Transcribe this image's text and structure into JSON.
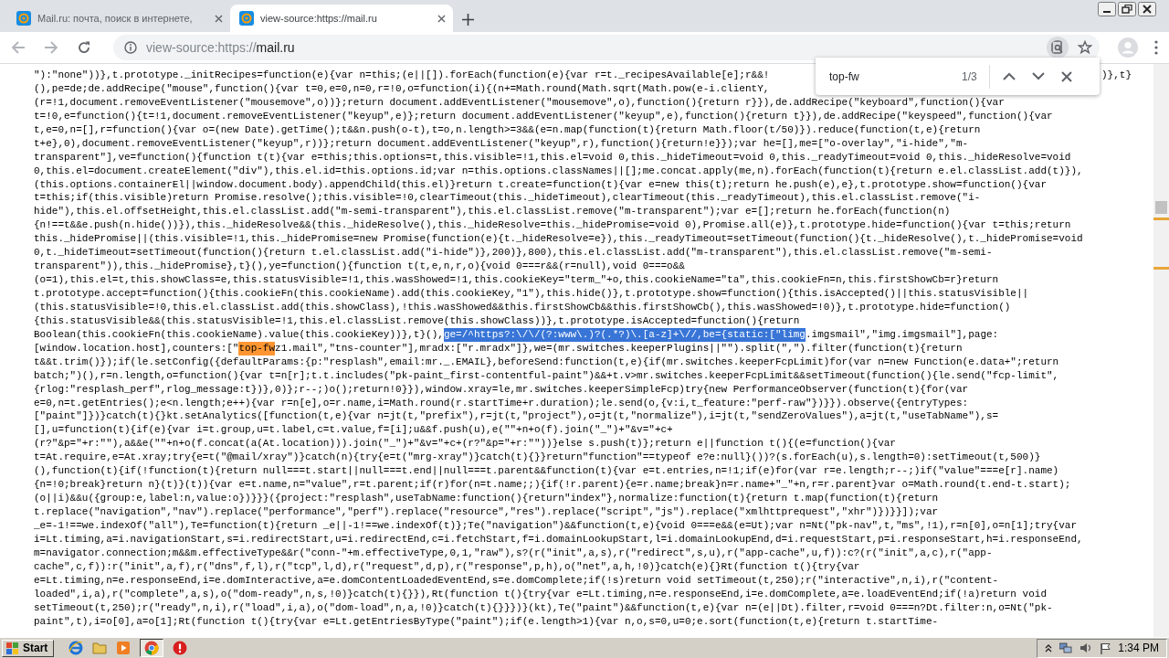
{
  "tabs": [
    {
      "title": "Mail.ru: почта, поиск в интернете,",
      "selected": false
    },
    {
      "title": "view-source:https://mail.ru",
      "selected": true
    }
  ],
  "address": {
    "prefix": "view-source:https://",
    "host": "mail.ru"
  },
  "find": {
    "query": "top-fw",
    "count": "1/3"
  },
  "source_lines": [
    {
      "text": "\"):\"none\"))},t.prototype._initRecipes=function(e){var n=this;(e||[]).forEach(function(e){var r=t._recipesAvailable[e];r&&!",
      "tail": ")},t}"
    },
    {
      "text": "(),pe=de;de.addRecipe(\"mouse\",function(){var t=0,e=0,n=0,r=!0,o=function(i){(n+=Math.round(Math.sqrt(Math.pow(e-i.clientY,"
    },
    {
      "text": "(r=!1,document.removeEventListener(\"mousemove\",o))};return document.addEventListener(\"mousemove\",o),function(){return r}}),de.addRecipe(\"keyboard\",function(){var"
    },
    {
      "text": "t=!0,e=function(){t=!1,document.removeEventListener(\"keyup\",e)};return document.addEventListener(\"keyup\",e),function(){return t}}),de.addRecipe(\"keyspeed\",function(){var"
    },
    {
      "text": "t,e=0,n=[],r=function(){var o=(new Date).getTime();t&&n.push(o-t),t=o,n.length>=3&&(e=n.map(function(t){return Math.floor(t/50)}).reduce(function(t,e){return"
    },
    {
      "text": "t+e},0),document.removeEventListener(\"keyup\",r))};return document.addEventListener(\"keyup\",r),function(){return!e}});var he=[],me=[\"o-overlay\",\"i-hide\",\"m-"
    },
    {
      "text": "transparent\"],ve=function(){function t(t){var e=this;this.options=t,this.visible=!1,this.el=void 0,this._hideTimeout=void 0,this._readyTimeout=void 0,this._hideResolve=void"
    },
    {
      "text": "0,this.el=document.createElement(\"div\"),this.el.id=this.options.id;var n=this.options.classNames||[];me.concat.apply(me,n).forEach(function(t){return e.el.classList.add(t)}),"
    },
    {
      "text": "(this.options.containerEl||window.document.body).appendChild(this.el)}return t.create=function(t){var e=new this(t);return he.push(e),e},t.prototype.show=function(){var"
    },
    {
      "text": "t=this;if(this.visible)return Promise.resolve();this.visible=!0,clearTimeout(this._hideTimeout),clearTimeout(this._readyTimeout),this.el.classList.remove(\"i-"
    },
    {
      "text": "hide\"),this.el.offsetHeight,this.el.classList.add(\"m-semi-transparent\"),this.el.classList.remove(\"m-transparent\");var e=[];return he.forEach(function(n)"
    },
    {
      "text": "{n!==t&&e.push(n.hide())}),this._hideResolve&&(this._hideResolve(),this._hideResolve=this._hidePromise=void 0),Promise.all(e)},t.prototype.hide=function(){var t=this;return"
    },
    {
      "text": "this._hidePromise||(this.visible=!1,this._hidePromise=new Promise(function(e){t._hideResolve=e}),this._readyTimeout=setTimeout(function(){t._hideResolve(),t._hidePromise=void"
    },
    {
      "text": "0,t._hideTimeout=setTimeout(function(){return t.el.classList.add(\"i-hide\")},200)},800),this.el.classList.add(\"m-transparent\"),this.el.classList.remove(\"m-semi-"
    },
    {
      "text": "transparent\")),this._hidePromise},t}(),ye=function(){function t(t,e,n,r,o){void 0===r&&(r=null),void 0===o&&"
    },
    {
      "text": "(o=1),this.el=t,this.showClass=e,this.statusVisible=!1,this.wasShowed=!1,this.cookieKey=\"term_\"+o,this.cookieName=\"ta\",this.cookieFn=n,this.firstShowCb=r}return"
    },
    {
      "text": "t.prototype.accept=function(){this.cookieFn(this.cookieName).add(this.cookieKey,\"1\"),this.hide()},t.prototype.show=function(){this.isAccepted()||this.statusVisible||"
    },
    {
      "text": "(this.statusVisible=!0,this.el.classList.add(this.showClass),!this.wasShowed&&this.firstShowCb&&this.firstShowCb(),this.wasShowed=!0)},t.prototype.hide=function()"
    },
    {
      "text": "{this.statusVisible&&(this.statusVisible=!1,this.el.classList.remove(this.showClass))},t.prototype.isAccepted=function(){return"
    },
    {
      "segments": [
        {
          "text": "Boolean(this.cookieFn(this.cookieName).value(this.cookieKey))},t}(),",
          "kind": "plain"
        },
        {
          "text": "ge=/^https?:\\/\\/(?:www\\.)?(.*?)\\.[a-z]+\\//,be={static:[\"limg",
          "kind": "selection"
        },
        {
          "text": ".imgsmail\",\"img.imgsmail\"],page:",
          "kind": "plain"
        }
      ]
    },
    {
      "segments": [
        {
          "text": "[window.location.host],counters:[\"",
          "kind": "plain"
        },
        {
          "text": "top-fw",
          "kind": "match"
        },
        {
          "text": "z1.mail\",\"tns-counter\"],mradx:[\"r.mradx\"]},we=(mr.switches.keeperPlugins||\"\").split(\",\").filter(function(t){return",
          "kind": "plain"
        }
      ]
    },
    {
      "text": "t&&t.trim()});if(le.setConfig({defaultParams:{p:\"resplash\",email:mr._.EMAIL},beforeSend:function(t,e){if(mr.switches.keeperFcpLimit)for(var n=new Function(e.data+\";return"
    },
    {
      "text": "batch;\")(),r=n.length,o=function(){var t=n[r];t.t.includes(\"pk-paint_first-contentful-paint\")&&+t.v>mr.switches.keeperFcpLimit&&setTimeout(function(){le.send(\"fcp-limit\","
    },
    {
      "text": "{rlog:\"resplash_perf\",rlog_message:t})},0)};r--;)o();return!0}}),window.xray=le,mr.switches.keeperSimpleFcp)try{new PerformanceObserver(function(t){for(var"
    },
    {
      "text": "e=0,n=t.getEntries();e<n.length;e++){var r=n[e],o=r.name,i=Math.round(r.startTime+r.duration);le.send(o,{v:i,t_feature:\"perf-raw\"})}}).observe({entryTypes:"
    },
    {
      "text": "[\"paint\"]})}catch(t){}kt.setAnalytics([function(t,e){var n=jt(t,\"prefix\"),r=jt(t,\"project\"),o=jt(t,\"normalize\"),i=jt(t,\"sendZeroValues\"),a=jt(t,\"useTabName\"),s="
    },
    {
      "text": "[],u=function(t){if(e){var i=t.group,u=t.label,c=t.value,f=[i];u&&f.push(u),e(\"\"+n+o(f).join(\"_\")+\"&v=\"+c+"
    },
    {
      "text": "(r?\"&p=\"+r:\"\"),a&&e(\"\"+n+o(f.concat(a(At.location))).join(\"_\")+\"&v=\"+c+(r?\"&p=\"+r:\"\"))}else s.push(t)};return e||function t(){(e=function(){var"
    },
    {
      "text": "t=At.require,e=At.xray;try{e=t(\"@mail/xray\")}catch(n){try{e=t(\"mrg-xray\")}catch(t){}}return\"function\"==typeof e?e:null}())?(s.forEach(u),s.length=0):setTimeout(t,500)}"
    },
    {
      "text": "(),function(t){if(!function(t){return null===t.start||null===t.end||null===t.parent&&function(t){var e=t.entries,n=!1;if(e)for(var r=e.length;r--;)if(\"value\"===e[r].name)"
    },
    {
      "text": "{n=!0;break}return n}(t)}(t)){var e=t.name,n=\"value\",r=t.parent;if(r)for(n=t.name;;){if(!r.parent){e=r.name;break}n=r.name+\"_\"+n,r=r.parent}var o=Math.round(t.end-t.start);"
    },
    {
      "text": "(o||i)&&u({group:e,label:n,value:o})}}}({project:\"resplash\",useTabName:function(){return\"index\"},normalize:function(t){return t.map(function(t){return"
    },
    {
      "text": "t.replace(\"navigation\",\"nav\").replace(\"performance\",\"perf\").replace(\"resource\",\"res\").replace(\"script\",\"js\").replace(\"xmlhttprequest\",\"xhr\")})}}]);var"
    },
    {
      "text": "_e=-1!==we.indexOf(\"all\"),Te=function(t){return _e||-1!==we.indexOf(t)};Te(\"navigation\")&&function(t,e){void 0===e&&(e=Ut);var n=Nt(\"pk-nav\",t,\"ms\",!1),r=n[0],o=n[1];try{var"
    },
    {
      "text": "i=Lt.timing,a=i.navigationStart,s=i.redirectStart,u=i.redirectEnd,c=i.fetchStart,f=i.domainLookupStart,l=i.domainLookupEnd,d=i.requestStart,p=i.responseStart,h=i.responseEnd,"
    },
    {
      "text": "m=navigator.connection;m&&m.effectiveType&&r(\"conn-\"+m.effectiveType,0,1,\"raw\"),s?(r(\"init\",a,s),r(\"redirect\",s,u),r(\"app-cache\",u,f)):c?(r(\"init\",a,c),r(\"app-"
    },
    {
      "text": "cache\",c,f)):r(\"init\",a,f),r(\"dns\",f,l),r(\"tcp\",l,d),r(\"request\",d,p),r(\"response\",p,h),o(\"net\",a,h,!0)}catch(e){}Rt(function t(){try{var"
    },
    {
      "text": "e=Lt.timing,n=e.responseEnd,i=e.domInteractive,a=e.domContentLoadedEventEnd,s=e.domComplete;if(!s)return void setTimeout(t,250);r(\"interactive\",n,i),r(\"content-"
    },
    {
      "text": "loaded\",i,a),r(\"complete\",a,s),o(\"dom-ready\",n,s,!0)}catch(t){}}),Rt(function t(){try{var e=Lt.timing,n=e.responseEnd,i=e.domComplete,a=e.loadEventEnd;if(!a)return void"
    },
    {
      "text": "setTimeout(t,250);r(\"ready\",n,i),r(\"load\",i,a),o(\"dom-load\",n,a,!0)}catch(t){}}})}(kt),Te(\"paint\")&&function(t,e){var n=(e||Dt).filter,r=void 0===n?Dt.filter:n,o=Nt(\"pk-"
    },
    {
      "text": "paint\",t),i=o[0],a=o[1];Rt(function t(){try{var e=Lt.getEntriesByType(\"paint\");if(e.length>1){var n,o,s=0,u=0;e.sort(function(t,e){return t.startTime-"
    }
  ],
  "taskbar": {
    "start": "Start",
    "clock": "1:34 PM"
  }
}
